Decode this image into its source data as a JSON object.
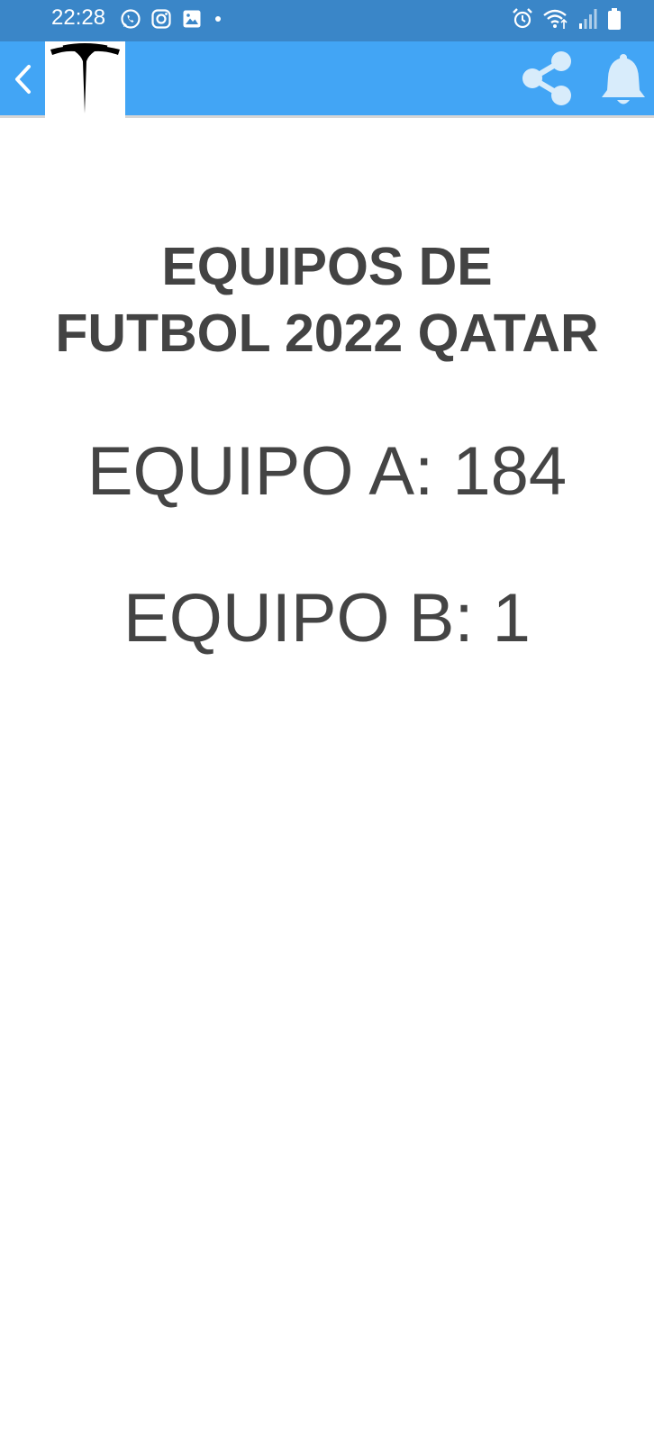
{
  "status_bar": {
    "time": "22:28",
    "left_icons": [
      "whatsapp-icon",
      "instagram-icon",
      "gallery-icon",
      "dot-icon"
    ],
    "right_icons": [
      "alarm-icon",
      "wifi-icon",
      "signal-icon",
      "battery-icon"
    ]
  },
  "app_bar": {
    "back_icon": "chevron-left-icon",
    "logo": "tesla-t-logo",
    "actions": [
      "share-icon",
      "bell-icon"
    ],
    "colors": {
      "background": "#42a5f5",
      "status_bar": "#3a86c8"
    }
  },
  "main": {
    "title": "EQUIPOS DE FUTBOL 2022 QATAR",
    "score_a": "EQUIPO A: 184",
    "score_b": "EQUIPO B: 1"
  }
}
